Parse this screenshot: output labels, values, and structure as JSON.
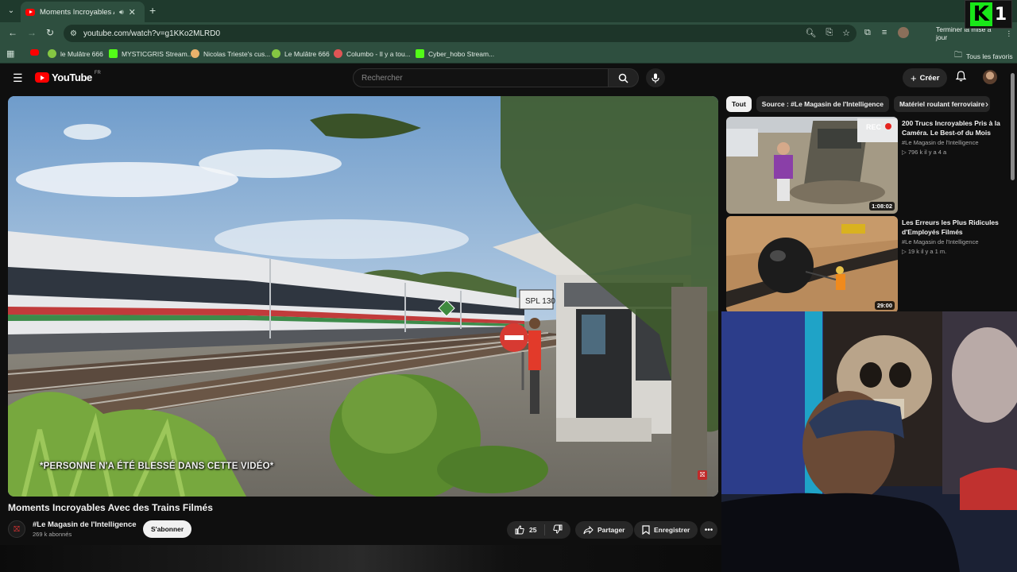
{
  "browser": {
    "tab": {
      "title": "Moments Incroyables Avec",
      "audio_icon": "speaker-icon",
      "close_icon": "close-icon"
    },
    "url": "youtube.com/watch?v=g1KKo2MLRD0",
    "update_button": "Terminer la mise à jour",
    "bookmarks": [
      {
        "label": "",
        "icon": "youtube",
        "color": "#ff0000"
      },
      {
        "label": "le Mulâtre 666",
        "icon": "rumble",
        "color": "#85c742"
      },
      {
        "label": "MYSTICGRIS Stream...",
        "icon": "kick",
        "color": "#53fc18"
      },
      {
        "label": "Nicolas Trieste's cus...",
        "icon": "custom",
        "color": "#e9b26b"
      },
      {
        "label": "Le Mulâtre 666",
        "icon": "rumble",
        "color": "#85c742"
      },
      {
        "label": "Columbo - Il y a tou...",
        "icon": "custom",
        "color": "#e05555"
      },
      {
        "label": "Cyber_hobo Stream...",
        "icon": "kick",
        "color": "#53fc18"
      }
    ],
    "all_bookmarks": "Tous les favoris"
  },
  "overlay_logo": {
    "letter": "K",
    "number": "1"
  },
  "youtube": {
    "logo_text": "YouTube",
    "logo_region": "FR",
    "search_placeholder": "Rechercher",
    "create_label": "Créer",
    "video": {
      "subtitle": "*PERSONNE N'A ÉTÉ BLESSÉ DANS CETTE VIDÉO*",
      "title": "Moments Incroyables Avec des Trains Filmés",
      "channel": "#Le Magasin de l'Intelligence",
      "subscribers": "269 k abonnés",
      "subscribe_label": "S'abonner",
      "likes": "25",
      "share_label": "Partager",
      "save_label": "Enregistrer",
      "signal_sign": "SPL 130"
    },
    "chips": [
      "Tout",
      "Source : #Le Magasin de l'Intelligence",
      "Matériel roulant ferroviaire"
    ],
    "recommendations": [
      {
        "title": "200 Trucs Incroyables Pris à la Caméra. Le Best-of du Mois",
        "channel": "#Le Magasin de l'Intelligence",
        "meta": "▷ 796 k  il y a 4 a",
        "duration": "1:08:02",
        "overlay": "REC"
      },
      {
        "title": "Les Erreurs les Plus Ridicules d'Employés Filmés",
        "channel": "#Le Magasin de l'Intelligence",
        "meta": "▷ 19 k  il y a 1 m.",
        "duration": "29:00"
      }
    ]
  },
  "colors": {
    "chrome_dark": "#1f3a2d",
    "chrome": "#2e4f3f",
    "youtube_red": "#ff0000",
    "kick_green": "#53fc18"
  }
}
